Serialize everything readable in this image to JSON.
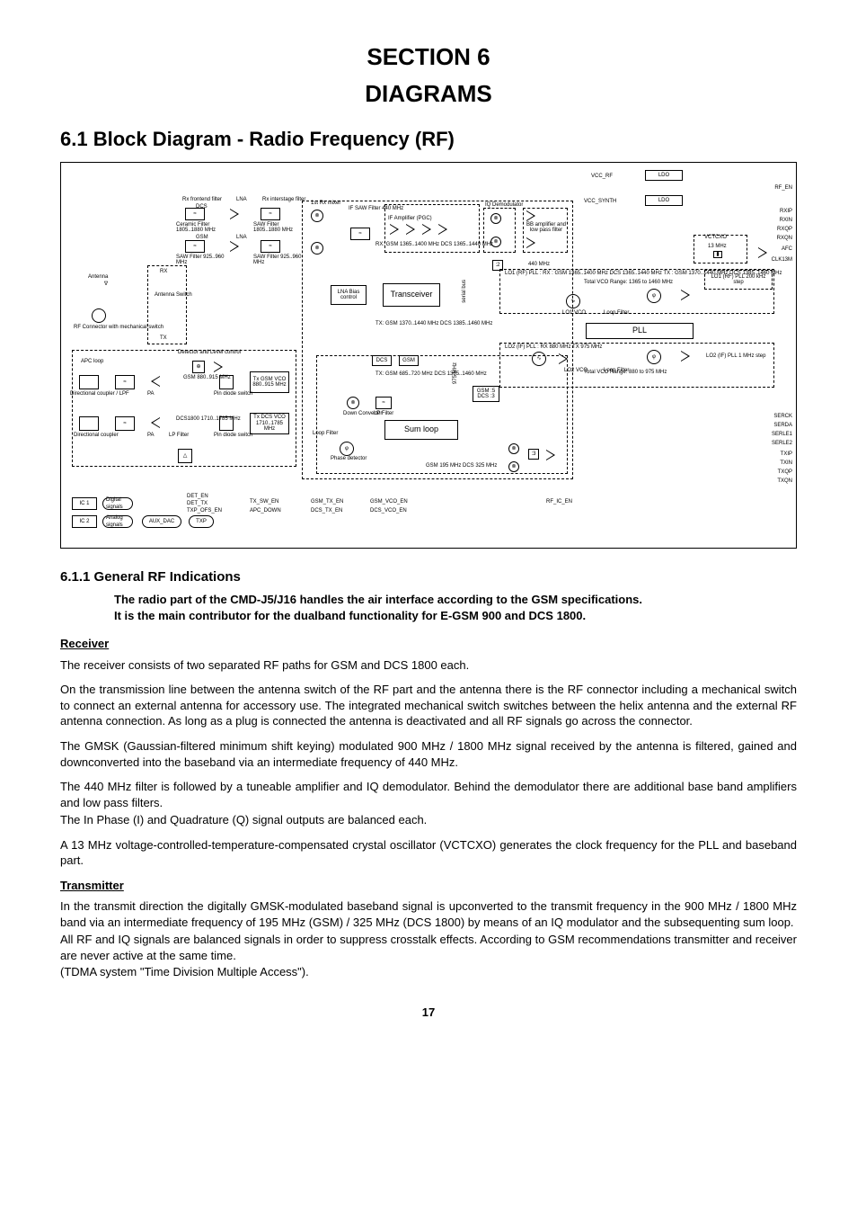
{
  "section_title_1": "SECTION 6",
  "section_title_2": "DIAGRAMS",
  "h2": "6.1 Block Diagram - Radio Frequency (RF)",
  "h3": "6.1.1 General RF Indications",
  "intro_line1": "The radio part of the CMD-J5/J16 handles the air interface according to the GSM specifications.",
  "intro_line2": "It is the main contributor for the dualband functionality for E-GSM 900 and DCS 1800.",
  "sub_receiver": "Receiver",
  "p_r1": "The receiver consists of two separated RF paths for GSM and DCS 1800 each.",
  "p_r2": "On the transmission line between the antenna switch of the RF part and the antenna there is the RF connector including a mechanical switch to connect an external antenna for accessory use. The integrated mechanical switch switches between the helix antenna and the external RF antenna connection. As long as a plug is connected the antenna is deactivated and all RF signals go across the connector.",
  "p_r3": "The GMSK (Gaussian-filtered minimum shift keying) modulated 900 MHz / 1800 MHz signal received by the antenna is filtered, gained and downconverted into the baseband via an intermediate frequency of 440 MHz.",
  "p_r4": "The 440 MHz filter is followed by a tuneable amplifier and IQ demodulator. Behind the demodulator there are additional base band amplifiers and low pass filters.",
  "p_r5": "The In Phase (I) and Quadrature (Q) signal outputs are balanced each.",
  "p_r6": "A 13 MHz voltage-controlled-temperature-compensated crystal oscillator (VCTCXO) generates the clock frequency for the PLL and baseband part.",
  "sub_transmitter": "Transmitter",
  "p_t1": "In the transmit direction the digitally GMSK-modulated baseband signal is upconverted to the transmit frequency in the 900 MHz / 1800 MHz band via an intermediate frequency of 195 MHz (GSM) / 325 MHz (DCS 1800) by means of an IQ modulator and the subsequenting sum loop.",
  "p_t2": "All RF and IQ signals are balanced signals in order to suppress crosstalk effects. According to GSM recommendations transmitter and receiver are never active at the same time.",
  "p_t3": "(TDMA system \"Time Division Multiple Access\").",
  "pagenum": "17",
  "diagram": {
    "top_labels": {
      "vcc_rf": "VCC_RF",
      "vcc_synth": "VCC_SYNTH",
      "ldo": "LDO",
      "rf_en": "RF_EN"
    },
    "rx_frontend": "Rx frontend filter",
    "rx_interstage": "Rx interstage filter",
    "lna": "LNA",
    "dcs": "DCS",
    "gsm": "GSM",
    "ceramic_filter": "Ceramic Filter\n1805..1880 MHz",
    "saw_filter_dcs": "SAW Filter\n1805..1880 MHz",
    "saw_filter_gsm": "SAW Filter\n925..960 MHz",
    "saw_filter_gsm2": "SAW Filter\n925..960 MHz",
    "first_mixer": "1st Rx mixer",
    "if_label": "IF\nSAW Filter\n440 MHz",
    "if_amp": "IF Amplifier (PGC)",
    "iq_demod": "IQ Demodulator",
    "bb_amp": "BB amplifier and\nlow pass filter",
    "lna_bias": "LNA Bias\ncontrol",
    "transceiver": "Transceiver",
    "antenna": "Antenna",
    "rx": "RX",
    "tx": "TX",
    "antenna_switch": "Antenna\nSwitch",
    "rf_connector": "RF Connector with\nmechanical switch",
    "detector": "Detector and\nLevel control",
    "apc_loop": "APC loop",
    "directional_coupler": "Directional\ncoupler / LPF",
    "directional_coupler2": "Directional\ncoupler",
    "gsm900_pa": "GSM\n880..915 MHz",
    "dcs1800_pa": "DCS1800\n1710..1785 MHz",
    "pin_diode": "Pin diode\nswitch",
    "pa": "PA",
    "lpf": "LP Filter",
    "tx_gsm_vco": "Tx GSM VCO\n880..915 MHz",
    "tx_dcs_vco": "Tx DCS VCO\n1710..1785 MHz",
    "loop_filter": "Loop\nFilter",
    "phase_det": "Phase\ndetector",
    "down_conv": "Down\nConverter",
    "lp_filter2": "LP Filter",
    "sum_loop": "Sum loop",
    "rx_freq_gsm": "RX:\nGSM 1365..1400 MHz\nDCS 1365..1440 MHz",
    "tx_freq_gsm": "TX:\nGSM 1370..1440 MHz\nDCS 1385..1460 MHz",
    "tx_freq2": "TX:\nGSM 685..720 MHz\nDCS 1385..1460 MHz",
    "f440": "440 MHz",
    "f975": "975 MHz",
    "lo1_pll": "LO1 (RF) PLL :\nRX :\nGSM 1365..1400 MHz\nDCS 1365..1440 MHz\nTX :\nGSM 1370..1440 MHz\nDCS 1385..1460 MHz",
    "total_vco1": "Total VCO Range:\n1365 to 1460 MHz",
    "lo1_vco": "LO1\nVCO",
    "loop_filter2": "Loop\nFilter",
    "lo1_rf_pll": "LO1 (RF) PLL\n200 kHz step",
    "lo2_pll": "LO2 (IF) PLL :\nRX 880 MHz\nTX 975 MHz",
    "lo2_vco": "LO2\nVCO",
    "total_vco2": "Total VCO Range:\n880 to 975 MHz",
    "lo2_if_pll": "LO2 (IF) PLL\n1 MHz step",
    "pll": "PLL",
    "gsm_dcs_div": "GSM :5\nDCS :3",
    "gsm_if": "GSM 195 MHz\nDCS 325 MHz",
    "vctcxo": "VCTCXO",
    "mhz13": "13 MHz",
    "phi": "φ",
    "div2": ":2",
    "div3": ":3",
    "ic1": "IC 1",
    "ic2": "IC 2",
    "digital_signals": "Digital\nsignals",
    "analog_signals": "Analog\nsignals",
    "aux_dac": "AUX_DAC",
    "txp": "TXP",
    "det_en": "DET_EN",
    "det_tx": "DET_TX",
    "txp_ofs": "TXP_OFS_EN",
    "tx_sw_en": "TX_SW_EN",
    "apc_down": "APC_DOWN",
    "gsm_tx_en": "GSM_TX_EN",
    "dcs_tx_en": "DCS_TX_EN",
    "gsm_vco_en": "GSM_VCO_EN",
    "dcs_vco_en": "DCS_VCO_EN",
    "rf_ic_en": "RF_IC_EN",
    "right_signals": {
      "rxip": "RXIP",
      "rxin": "RXIN",
      "rxqp": "RXQP",
      "rxqn": "RXQN",
      "afc": "AFC",
      "clk13m": "CLK13M",
      "serck": "SERCK",
      "serda": "SERDA",
      "serle1": "SERLE1",
      "serle2": "SERLE2",
      "txip": "TXIP",
      "txin": "TXIN",
      "txqp": "TXQP",
      "txqn": "TXQN"
    }
  }
}
